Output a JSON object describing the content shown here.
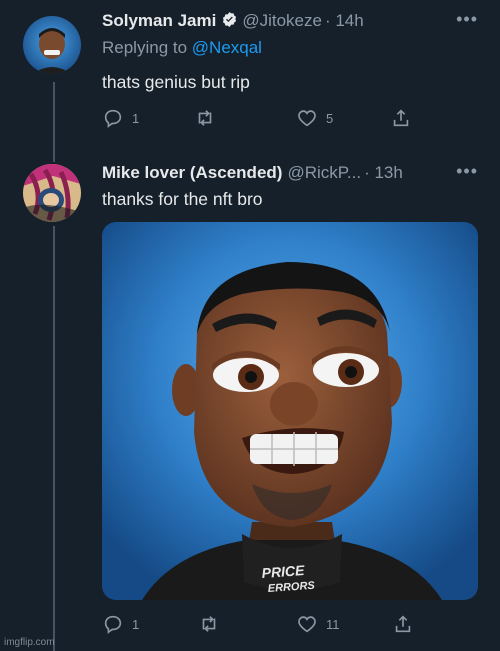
{
  "tweets": [
    {
      "name": "Solyman Jami",
      "handle": "@Jitokeze",
      "time": "· 14h",
      "replying_prefix": "Replying to ",
      "replying_mention": "@Nexqal",
      "text": "thats genius but rip",
      "reply_count": "1",
      "like_count": "5"
    },
    {
      "name": "Mike lover (Ascended)",
      "handle": "@RickP...",
      "time": "· 13h",
      "text": "thanks for the nft bro",
      "reply_count": "1",
      "like_count": "11"
    }
  ],
  "media": {
    "shirt_text_1": "PRICE",
    "shirt_text_2": "ERRORS"
  },
  "watermark": "imgflip.com",
  "colors": {
    "background": "#15202b",
    "accent": "#1d9bf0",
    "muted": "#8b98a5"
  }
}
